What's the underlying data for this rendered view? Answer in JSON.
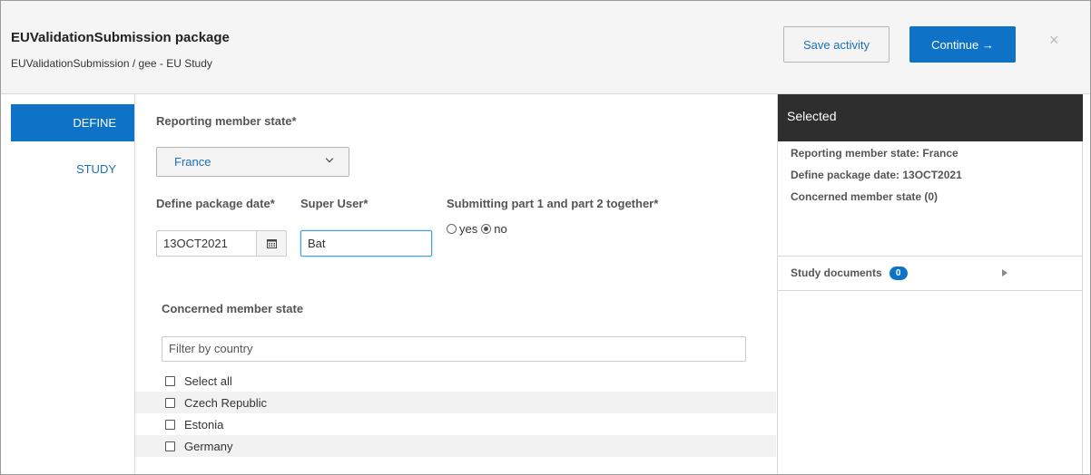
{
  "header": {
    "title": "EUValidationSubmission package",
    "breadcrumb": "EUValidationSubmission / gee - EU Study",
    "save_label": "Save activity",
    "continue_label": "Continue →",
    "close_glyph": "×"
  },
  "nav": {
    "items": [
      {
        "label": "DEFINE",
        "active": true
      },
      {
        "label": "STUDY",
        "active": false
      }
    ]
  },
  "form": {
    "reporting_label": "Reporting member state*",
    "reporting_value": "France",
    "date_label": "Define package date*",
    "date_value": "13OCT2021",
    "super_user_label": "Super User*",
    "super_user_value": "Bat",
    "submitting_label": "Submitting part 1 and part 2 together*",
    "yes_label": "yes",
    "no_label": "no",
    "selected_option": "no",
    "concerned_label": "Concerned member state",
    "filter_placeholder": "Filter by country",
    "countries": [
      {
        "label": "Select all",
        "checked": false
      },
      {
        "label": "Czech Republic",
        "checked": false
      },
      {
        "label": "Estonia",
        "checked": false
      },
      {
        "label": "Germany",
        "checked": false
      }
    ]
  },
  "selected_panel": {
    "title": "Selected",
    "lines": [
      "Reporting member state: France",
      "Define package date: 13OCT2021",
      "Concerned member state (0)"
    ],
    "study_documents_label": "Study documents",
    "study_documents_count": "0"
  },
  "colors": {
    "accent": "#0e73c6",
    "panel_header": "#2e2e2e",
    "link": "#1a6fb7"
  },
  "icons": [
    "calendar-icon",
    "chevron-down-icon",
    "close-icon",
    "caret-right-icon"
  ]
}
